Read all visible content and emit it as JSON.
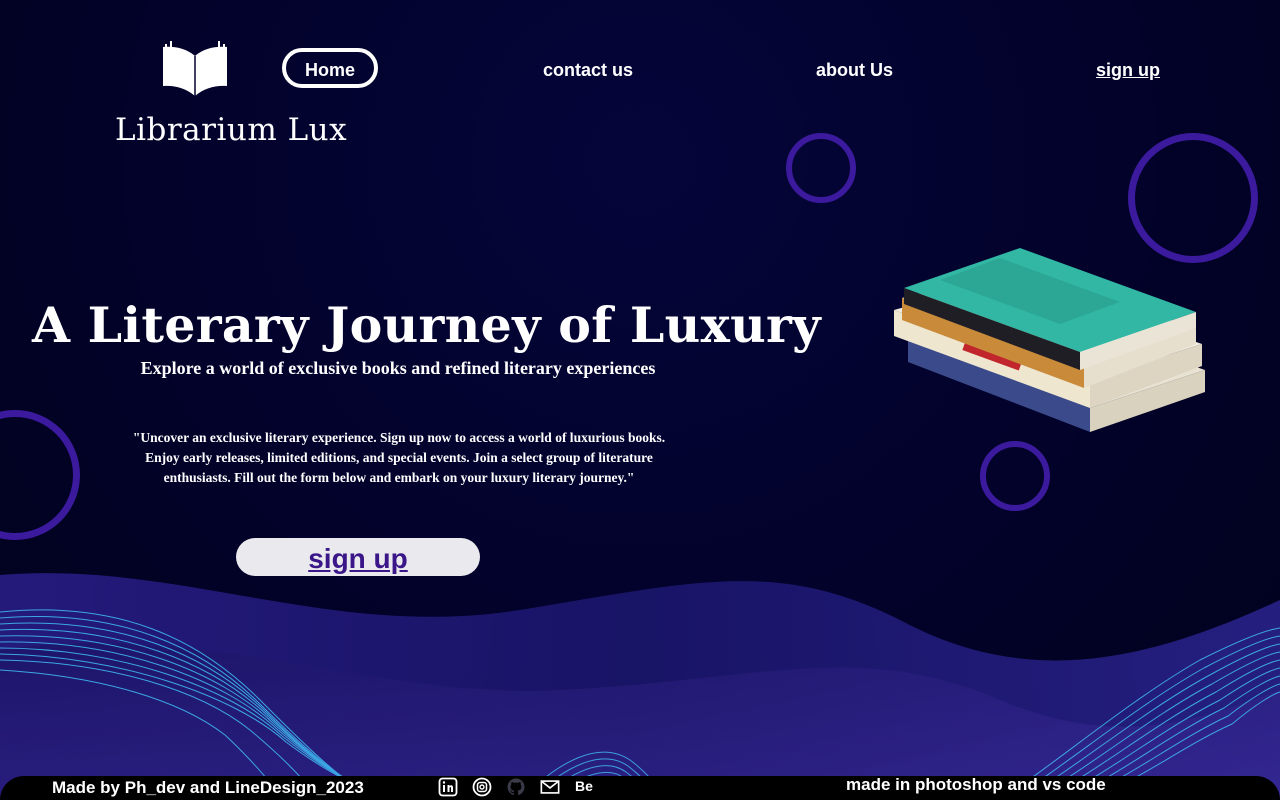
{
  "brand": {
    "name": "Librarium Lux",
    "logo_icon": "open-book-icon"
  },
  "nav": {
    "home": "Home",
    "contact": "contact us",
    "about": "about Us",
    "signup": "sign up"
  },
  "hero": {
    "title": "A Literary Journey of Luxury",
    "subtitle": "Explore a world of exclusive books and refined literary experiences",
    "quote": "\"Uncover an exclusive literary experience. Sign up now to access a world of luxurious books. Enjoy early releases, limited editions, and special events. Join a select group of literature enthusiasts. Fill out the form below and embark on your luxury literary journey.\"",
    "cta": "sign up"
  },
  "footer": {
    "credit": "Made by Ph_dev and LineDesign_2023",
    "tools": "made in photoshop and vs code",
    "social": [
      {
        "name": "linkedin-icon"
      },
      {
        "name": "instagram-icon"
      },
      {
        "name": "github-icon"
      },
      {
        "name": "mail-icon"
      },
      {
        "name": "behance-icon",
        "label": "Be"
      }
    ]
  },
  "colors": {
    "background": "#02022a",
    "accent_ring": "#3b1a9e",
    "cta_bg": "#e9e9ee",
    "cta_text": "#3a1688",
    "wave_lines": "#3fb6f0"
  }
}
